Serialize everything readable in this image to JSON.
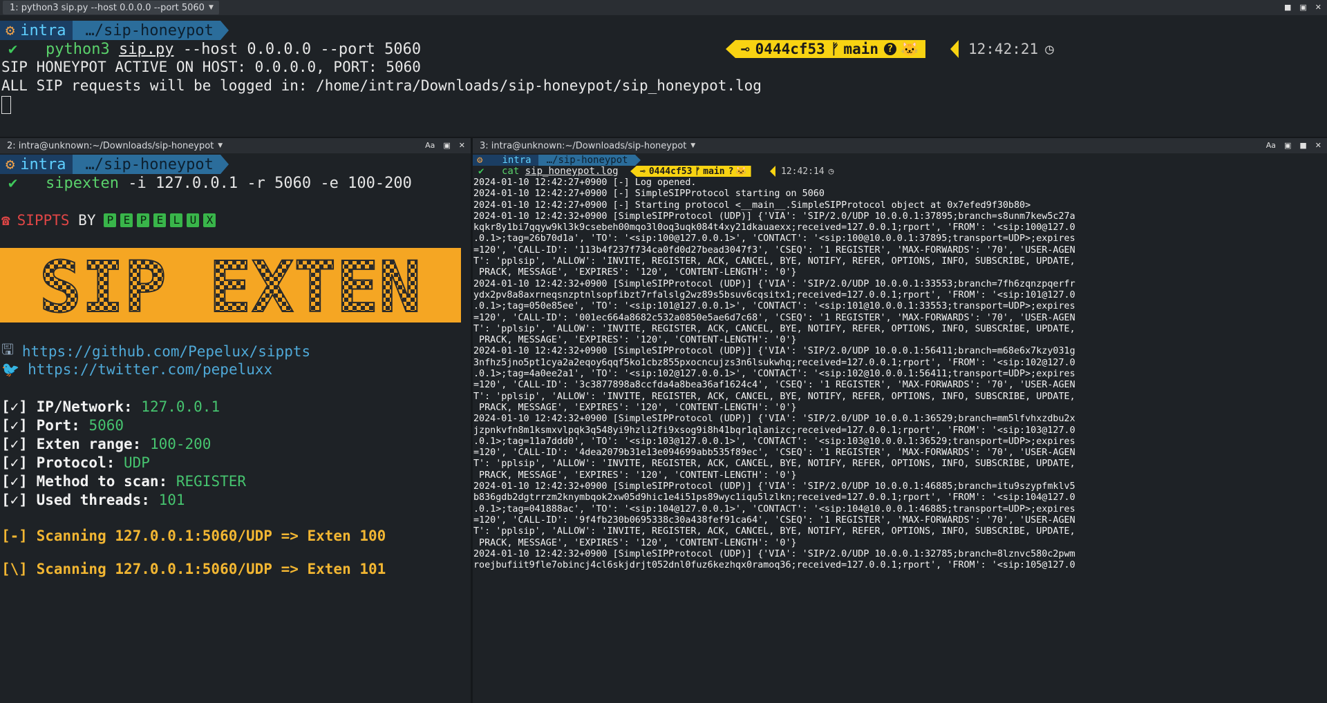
{
  "pane1": {
    "title": "1: python3 sip.py --host 0.0.0.0 --port 5060",
    "prompt_user": "intra",
    "prompt_path": "…/sip-honeypot",
    "cmd_prog": "python3",
    "cmd_file": "sip.py",
    "cmd_args": " --host 0.0.0.0 --port 5060",
    "git_hash": "0444cf53",
    "git_branch": "main",
    "time": "12:42:21",
    "output": [
      "SIP HONEYPOT ACTIVE ON HOST: 0.0.0.0, PORT: 5060",
      "ALL SIP requests will be logged in: /home/intra/Downloads/sip-honeypot/sip_honeypot.log"
    ]
  },
  "pane2": {
    "title": "2: intra@unknown:~/Downloads/sip-honeypot",
    "prompt_user": "intra",
    "prompt_path": "…/sip-honeypot",
    "cmd_prog": "sipexten",
    "cmd_args": " -i 127.0.0.1 -r 5060 -e 100-200",
    "sippts_label": "SIPPTS",
    "by_label": "BY",
    "pepelux_letters": [
      "P",
      "E",
      "P",
      "E",
      "L",
      "U",
      "X"
    ],
    "banner_text": "SIP EXTEN",
    "github_url": "https://github.com/Pepelux/sippts",
    "twitter_url": "https://twitter.com/pepeluxx",
    "checks": [
      {
        "label": "[✓] IP/Network: ",
        "value": "127.0.0.1"
      },
      {
        "label": "[✓] Port: ",
        "value": "5060"
      },
      {
        "label": "[✓] Exten range: ",
        "value": "100-200"
      },
      {
        "label": "[✓] Protocol: ",
        "value": "UDP"
      },
      {
        "label": "[✓] Method to scan: ",
        "value": "REGISTER"
      },
      {
        "label": "[✓] Used threads: ",
        "value": "101"
      }
    ],
    "scan_lines": [
      "[-] Scanning 127.0.0.1:5060/UDP => Exten 100",
      "[\\] Scanning 127.0.0.1:5060/UDP => Exten 101"
    ]
  },
  "pane3": {
    "title": "3: intra@unknown:~/Downloads/sip-honeypot",
    "prompt_user": "intra",
    "prompt_path": "…/sip-honeypot",
    "cmd_prog": "cat",
    "cmd_file": "sip_honeypot.log",
    "git_hash": "0444cf53",
    "git_branch": "main",
    "time": "12:42:14",
    "log_lines": [
      "2024-01-10 12:42:27+0900 [-] Log opened.",
      "2024-01-10 12:42:27+0900 [-] SimpleSIPProtocol starting on 5060",
      "2024-01-10 12:42:27+0900 [-] Starting protocol <__main__.SimpleSIPProtocol object at 0x7efed9f30b80>",
      "2024-01-10 12:42:32+0900 [SimpleSIPProtocol (UDP)] {'VIA': 'SIP/2.0/UDP 10.0.0.1:37895;branch=s8unm7kew5c27a",
      "kqkr8y1bi7qqyw9kl3k9csebeh00mqo3l0oq3uqk084t4xy21dkauaexx;received=127.0.0.1;rport', 'FROM': '<sip:100@127.0",
      ".0.1>;tag=26b70d1a', 'TO': '<sip:100@127.0.0.1>', 'CONTACT': '<sip:100@10.0.0.1:37895;transport=UDP>;expires",
      "=120', 'CALL-ID': '113b4f237f734ca0fd0d27bead3047f3', 'CSEQ': '1 REGISTER', 'MAX-FORWARDS': '70', 'USER-AGEN",
      "T': 'pplsip', 'ALLOW': 'INVITE, REGISTER, ACK, CANCEL, BYE, NOTIFY, REFER, OPTIONS, INFO, SUBSCRIBE, UPDATE,",
      " PRACK, MESSAGE', 'EXPIRES': '120', 'CONTENT-LENGTH': '0'}",
      "2024-01-10 12:42:32+0900 [SimpleSIPProtocol (UDP)] {'VIA': 'SIP/2.0/UDP 10.0.0.1:33553;branch=7fh6zqnzpqerfr",
      "ydx2pv8a8axrneqsnzptnlsopfibzt7rfalslg2wz89s5bsuv6cqsitx1;received=127.0.0.1;rport', 'FROM': '<sip:101@127.0",
      ".0.1>;tag=050e85ee', 'TO': '<sip:101@127.0.0.1>', 'CONTACT': '<sip:101@10.0.0.1:33553;transport=UDP>;expires",
      "=120', 'CALL-ID': '001ec664a8682c532a0850e5ae6d7c68', 'CSEQ': '1 REGISTER', 'MAX-FORWARDS': '70', 'USER-AGEN",
      "T': 'pplsip', 'ALLOW': 'INVITE, REGISTER, ACK, CANCEL, BYE, NOTIFY, REFER, OPTIONS, INFO, SUBSCRIBE, UPDATE,",
      " PRACK, MESSAGE', 'EXPIRES': '120', 'CONTENT-LENGTH': '0'}",
      "2024-01-10 12:42:32+0900 [SimpleSIPProtocol (UDP)] {'VIA': 'SIP/2.0/UDP 10.0.0.1:56411;branch=m68e6x7kzy031g",
      "3nfhz5jno5pt1cya2a2eqoy6qqf5ko1cbz855pxocncujzs3n6lsukwhq;received=127.0.0.1;rport', 'FROM': '<sip:102@127.0",
      ".0.1>;tag=4a0ee2a1', 'TO': '<sip:102@127.0.0.1>', 'CONTACT': '<sip:102@10.0.0.1:56411;transport=UDP>;expires",
      "=120', 'CALL-ID': '3c3877898a8ccfda4a8bea36af1624c4', 'CSEQ': '1 REGISTER', 'MAX-FORWARDS': '70', 'USER-AGEN",
      "T': 'pplsip', 'ALLOW': 'INVITE, REGISTER, ACK, CANCEL, BYE, NOTIFY, REFER, OPTIONS, INFO, SUBSCRIBE, UPDATE,",
      " PRACK, MESSAGE', 'EXPIRES': '120', 'CONTENT-LENGTH': '0'}",
      "2024-01-10 12:42:32+0900 [SimpleSIPProtocol (UDP)] {'VIA': 'SIP/2.0/UDP 10.0.0.1:36529;branch=mm5lfvhxzdbu2x",
      "jzpnkvfn8m1ksmxvlpqk3q548yi9hzli2fi9xsog9i8h41bqr1qlanizc;received=127.0.0.1;rport', 'FROM': '<sip:103@127.0",
      ".0.1>;tag=11a7ddd0', 'TO': '<sip:103@127.0.0.1>', 'CONTACT': '<sip:103@10.0.0.1:36529;transport=UDP>;expires",
      "=120', 'CALL-ID': '4dea2079b31e13e094699abb535f89ec', 'CSEQ': '1 REGISTER', 'MAX-FORWARDS': '70', 'USER-AGEN",
      "T': 'pplsip', 'ALLOW': 'INVITE, REGISTER, ACK, CANCEL, BYE, NOTIFY, REFER, OPTIONS, INFO, SUBSCRIBE, UPDATE,",
      " PRACK, MESSAGE', 'EXPIRES': '120', 'CONTENT-LENGTH': '0'}",
      "2024-01-10 12:42:32+0900 [SimpleSIPProtocol (UDP)] {'VIA': 'SIP/2.0/UDP 10.0.0.1:46885;branch=itu9szypfmklv5",
      "b836gdb2dgtrrzm2knymbqok2xw05d9hic1e4i51ps89wyc1iqu5lzlkn;received=127.0.0.1;rport', 'FROM': '<sip:104@127.0",
      ".0.1>;tag=041888ac', 'TO': '<sip:104@127.0.0.1>', 'CONTACT': '<sip:104@10.0.0.1:46885;transport=UDP>;expires",
      "=120', 'CALL-ID': '9f4fb230b0695338c30a438fef91ca64', 'CSEQ': '1 REGISTER', 'MAX-FORWARDS': '70', 'USER-AGEN",
      "T': 'pplsip', 'ALLOW': 'INVITE, REGISTER, ACK, CANCEL, BYE, NOTIFY, REFER, OPTIONS, INFO, SUBSCRIBE, UPDATE,",
      " PRACK, MESSAGE', 'EXPIRES': '120', 'CONTENT-LENGTH': '0'}",
      "2024-01-10 12:42:32+0900 [SimpleSIPProtocol (UDP)] {'VIA': 'SIP/2.0/UDP 10.0.0.1:32785;branch=8lznvc580c2pwm",
      "roejbufiit9fle7obincj4cl6skjdrjt052dnl0fuz6kezhqx0ramoq36;received=127.0.0.1;rport', 'FROM': '<sip:105@127.0"
    ]
  },
  "colors": {
    "background": "#1e2226",
    "banner": "#f5a623",
    "git_badge": "#f8d312",
    "prompt_path": "#2b6d9b",
    "prompt_user": "#1b3e63",
    "check_value": "#46c46f",
    "scan_text": "#f2b632",
    "link": "#4fa9d8"
  },
  "icons": {
    "os_logo": "ubuntu-icon",
    "check": "checkmark-icon",
    "git_commit": "git-commit-icon",
    "git_branch": "git-branch-icon",
    "question": "question-icon",
    "github": "github-icon",
    "clock": "clock-icon",
    "phone": "telephone-icon",
    "floppy": "floppy-disk-icon",
    "bird": "twitter-bird-icon"
  }
}
